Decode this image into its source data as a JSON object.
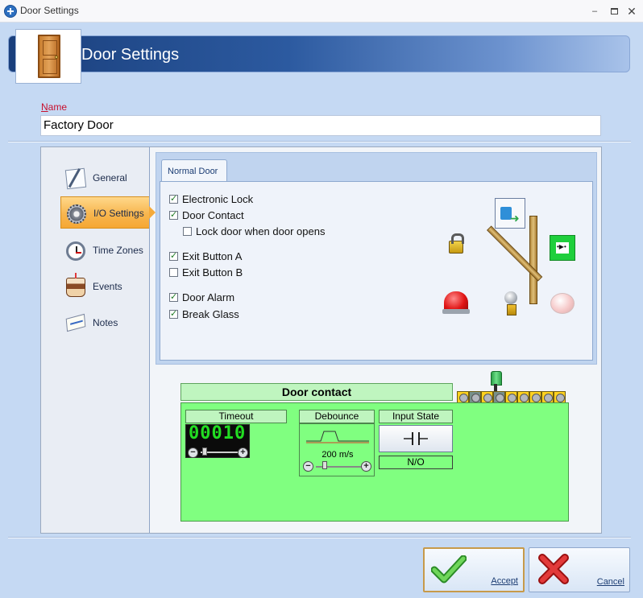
{
  "window": {
    "title": "Door Settings",
    "controls": {
      "minimize": "‒",
      "close": "✕"
    }
  },
  "header": {
    "title": "Door Settings"
  },
  "name_field": {
    "label_underlined": "N",
    "label_rest": "ame",
    "value": "Factory Door"
  },
  "nav": {
    "items": [
      {
        "label": "General",
        "icon": "pencil-paper-icon"
      },
      {
        "label": "I/O Settings",
        "icon": "gear-icon",
        "active": true
      },
      {
        "label": "Time Zones",
        "icon": "clock-icon"
      },
      {
        "label": "Events",
        "icon": "cake-icon"
      },
      {
        "label": "Notes",
        "icon": "notepad-icon"
      }
    ]
  },
  "tab": {
    "label": "Normal Door"
  },
  "options": [
    {
      "label": "Electronic Lock",
      "checked": true
    },
    {
      "label": "Door Contact",
      "checked": true
    },
    {
      "label": "Lock door when door opens",
      "checked": false
    },
    {
      "label": "Exit Button A",
      "checked": true
    },
    {
      "label": "Exit Button B",
      "checked": false
    },
    {
      "label": "Door Alarm",
      "checked": true
    },
    {
      "label": "Break Glass",
      "checked": true
    }
  ],
  "module": {
    "title": "Door contact",
    "timeout": {
      "label": "Timeout",
      "display": "00010"
    },
    "debounce": {
      "label": "Debounce",
      "value": "200 m/s"
    },
    "input_state": {
      "label": "Input State",
      "value": "N/O"
    },
    "terminals": [
      "0",
      "1",
      "2",
      "3",
      "4",
      "5",
      "6",
      "7",
      "8"
    ],
    "highlighted_terminals": [
      "1",
      "3"
    ]
  },
  "buttons": {
    "accept": "Accept",
    "cancel": "Cancel"
  },
  "colors": {
    "banner": "#1a3f7c",
    "active_nav": "#f5a733",
    "module_bg": "#80ff80",
    "module_header": "#bff5bf",
    "terminal": "#ffd21f",
    "required_label": "#c8102e"
  }
}
